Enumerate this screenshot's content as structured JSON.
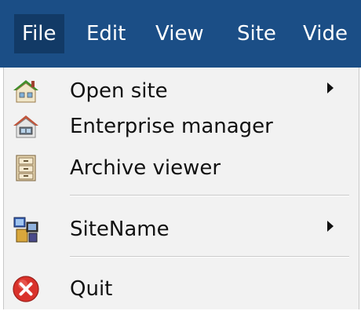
{
  "menubar": {
    "items": [
      {
        "label": "File",
        "active": true
      },
      {
        "label": "Edit"
      },
      {
        "label": "View"
      },
      {
        "label": "Site"
      },
      {
        "label": "Vide"
      }
    ]
  },
  "file_menu": {
    "items": [
      {
        "label": "Open site",
        "icon": "house-icon",
        "has_submenu": true
      },
      {
        "label": "Enterprise manager",
        "icon": "enterprise-house-icon",
        "has_submenu": false
      },
      {
        "label": "Archive viewer",
        "icon": "filing-cabinet-icon",
        "has_submenu": false
      },
      {
        "label": "SiteName",
        "icon": "site-computers-icon",
        "has_submenu": true
      },
      {
        "label": "Quit",
        "icon": "quit-icon",
        "has_submenu": false
      }
    ]
  },
  "colors": {
    "menubar_bg": "#1b4e86",
    "menubar_active": "#123a66",
    "menu_bg": "#f2f2f2",
    "quit_red": "#d9322b"
  }
}
